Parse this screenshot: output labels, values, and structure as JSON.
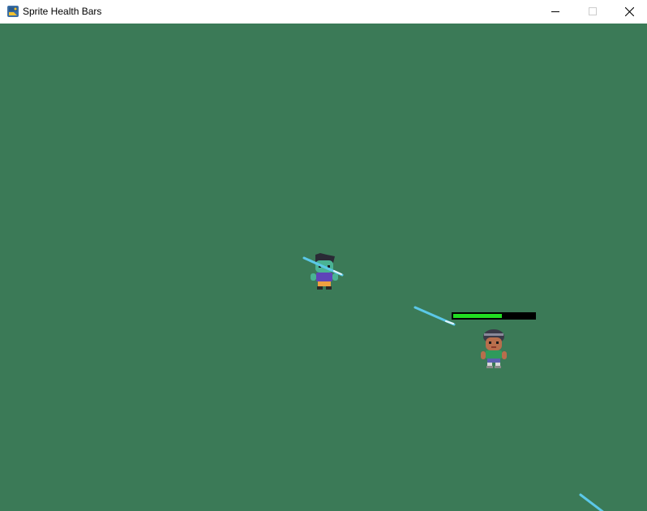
{
  "window": {
    "title": "Sprite Health Bars",
    "icon": "python-icon",
    "controls": [
      "minimize-icon",
      "maximize-icon",
      "close-icon"
    ]
  },
  "game": {
    "background_color": "#3b7a57",
    "player": {
      "health_fraction": 0.6,
      "health_color": "#22dd22",
      "health_background": "#000000"
    },
    "enemy": {
      "sprite": "zombie"
    },
    "projectile_color": "#5bc8e8"
  }
}
